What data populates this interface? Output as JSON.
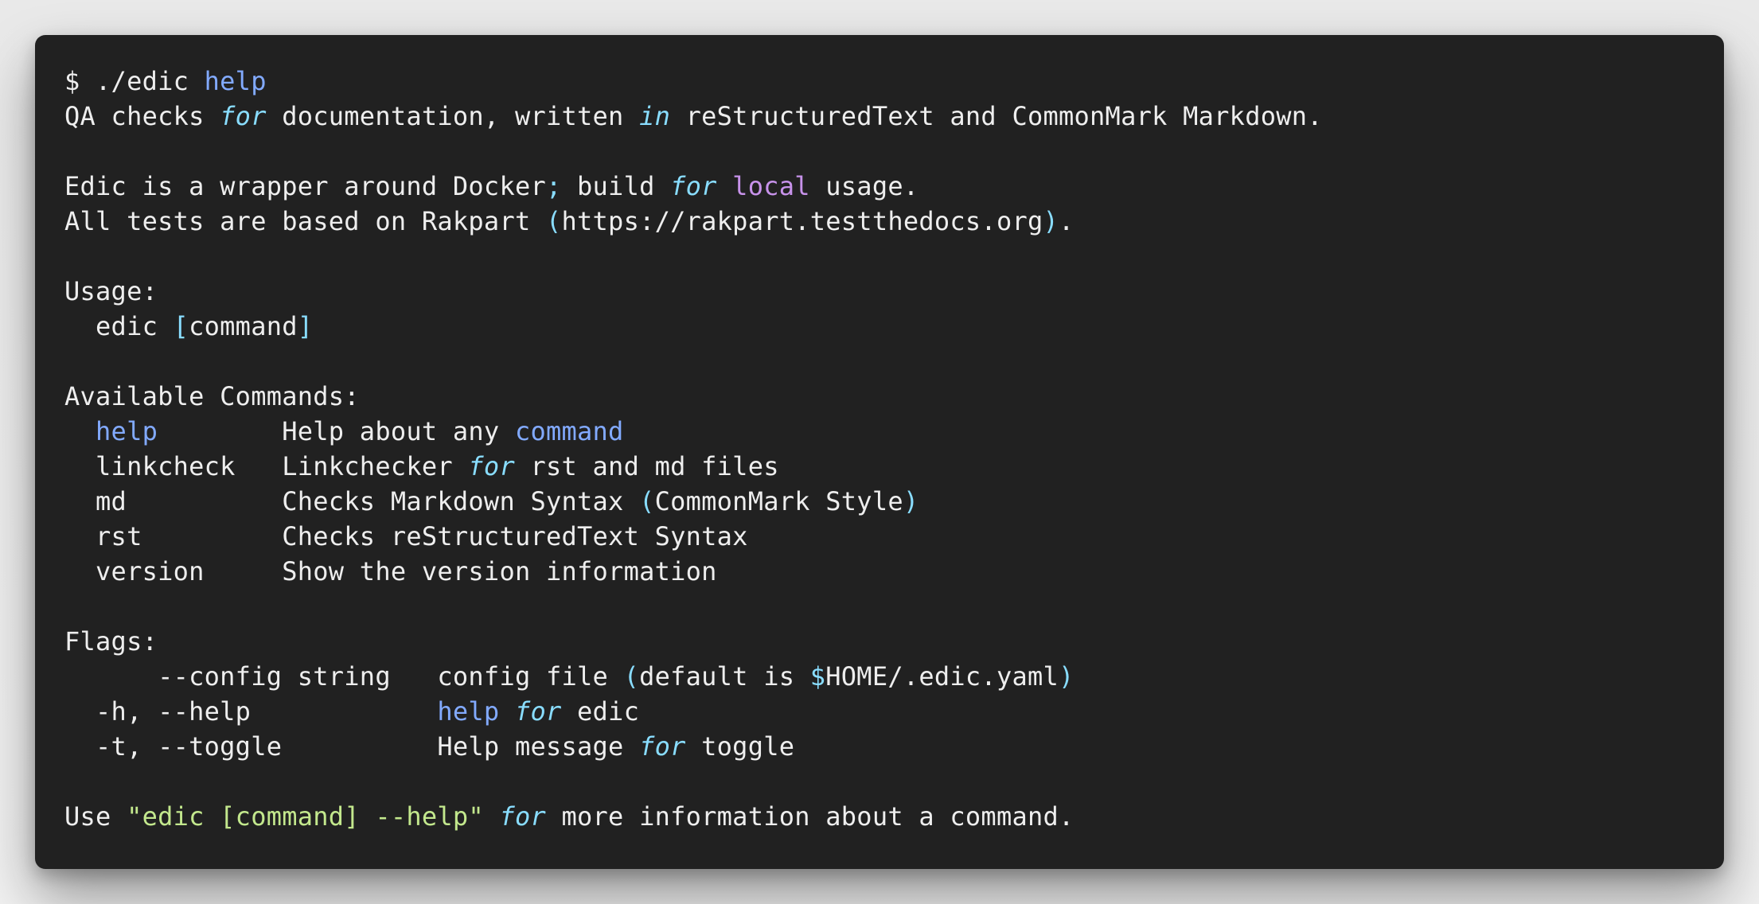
{
  "prompt": {
    "symbol": "$",
    "executable": "./edic",
    "argument": "help"
  },
  "description": {
    "line1": {
      "t1": "QA checks ",
      "kw1": "for",
      "t2": " documentation, written ",
      "kw2": "in",
      "t3": " reStructuredText and CommonMark Markdown."
    },
    "line2": {
      "t1": "Edic is a wrapper around Docker",
      "semi": ";",
      "t2": " build ",
      "kw1": "for",
      "space": " ",
      "local": "local",
      "t3": " usage."
    },
    "line3": {
      "t1": "All tests are based on Rakpart ",
      "open": "(",
      "url": "https://rakpart.testthedocs.org",
      "close": ")",
      "dot": "."
    }
  },
  "usage": {
    "heading": "Usage:",
    "cmd": "  edic ",
    "open": "[",
    "arg": "command",
    "close": "]"
  },
  "commands": {
    "heading": "Available Commands:",
    "help": {
      "name": "help",
      "pad": "        ",
      "desc1": "Help about any ",
      "desc_kw": "command"
    },
    "linkcheck": {
      "name": "linkcheck",
      "pad": "   ",
      "desc1": "Linkchecker ",
      "kw": "for",
      "desc2": " rst and md files"
    },
    "md": {
      "name": "md",
      "pad": "          ",
      "desc1": "Checks Markdown Syntax ",
      "open": "(",
      "inner": "CommonMark Style",
      "close": ")"
    },
    "rst": {
      "name": "rst",
      "pad": "         ",
      "desc": "Checks reStructuredText Syntax"
    },
    "version": {
      "name": "version",
      "pad": "     ",
      "desc": "Show the version information"
    }
  },
  "flags": {
    "heading": "Flags:",
    "config": {
      "name": "      --config string   ",
      "desc1": "config file ",
      "open": "(",
      "desc2": "default is ",
      "dollar": "$",
      "desc3": "HOME/.edic.yaml",
      "close": ")"
    },
    "help": {
      "name": "  -h, --help            ",
      "kw": "help",
      "sp": " ",
      "for": "for",
      "desc": " edic"
    },
    "toggle": {
      "name": "  -t, --toggle          ",
      "desc1": "Help message ",
      "for": "for",
      "desc2": " toggle"
    }
  },
  "footer": {
    "t1": "Use ",
    "str": "\"edic [command] --help\"",
    "sp": " ",
    "for": "for",
    "t2": " more information about a command."
  },
  "colors": {
    "background": "#212121",
    "foreground": "#eeeeee",
    "keyword_blue": "#82aaff",
    "italic_cyan": "#89ddff",
    "purple": "#c792ea",
    "string_green": "#c3e88d"
  }
}
